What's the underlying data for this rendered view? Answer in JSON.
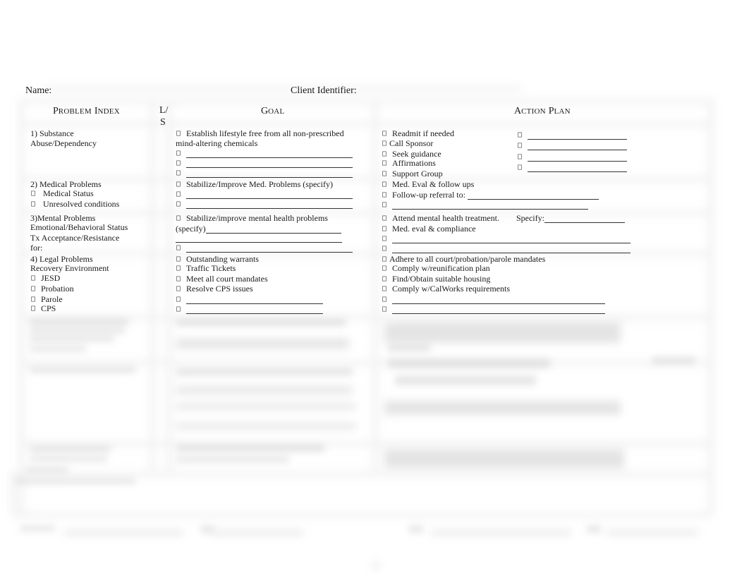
{
  "header": {
    "name_label": "Name:",
    "client_id_label": "Client Identifier:"
  },
  "columns": {
    "problem_index": {
      "cap1": "P",
      "rest1": "ROBLEM",
      "cap2": "I",
      "rest2": "NDEX"
    },
    "ls": {
      "line1": "L/",
      "line2": "S"
    },
    "goal": {
      "cap": "G",
      "rest": "OAL"
    },
    "action_plan": {
      "cap1": "A",
      "rest1": "CTION",
      "cap2": "P",
      "rest2": "LAN"
    }
  },
  "rows": [
    {
      "problem": [
        "1) Substance",
        "Abuse/Dependency"
      ],
      "goals": [
        "Establish lifestyle free from all non-prescribed",
        "mind-altering chemicals"
      ],
      "actions": [
        "Readmit if needed",
        "Call Sponsor",
        "Seek guidance",
        "Affirmations",
        "Support Group"
      ]
    },
    {
      "problem": [
        "2) Medical Problems",
        "Medical Status",
        "Unresolved conditions"
      ],
      "goals": [
        "Stabilize/Improve Med. Problems (specify)"
      ],
      "actions": [
        "Med. Eval & follow ups",
        "Follow-up referral to:"
      ]
    },
    {
      "problem": [
        "3)Mental Problems",
        "Emotional/Behavioral Status",
        "Tx Acceptance/Resistance",
        "for:"
      ],
      "goals": [
        "Stabilize/improve mental health problems",
        "(specify)"
      ],
      "actions": [
        "Attend mental health treatment.",
        "Specify:",
        "Med. eval & compliance"
      ]
    },
    {
      "problem": [
        "4) Legal Problems",
        "Recovery Environment",
        "JESD",
        "Probation",
        "Parole",
        "CPS"
      ],
      "goals": [
        "Outstanding warrants",
        "Traffic Tickets",
        "Meet all court mandates",
        "Resolve CPS issues"
      ],
      "actions": [
        "Adhere to all court/probation/parole mandates",
        "Comply w/reunification plan",
        "Find/Obtain suitable housing",
        "Comply w/CalWorks requirements"
      ]
    }
  ]
}
